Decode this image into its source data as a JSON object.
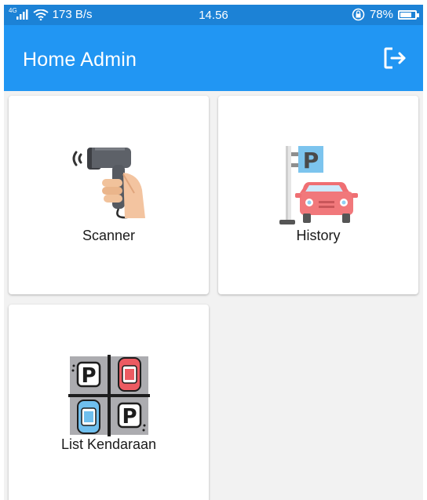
{
  "status_bar": {
    "network": "4G",
    "speed": "173 B/s",
    "time": "14.56",
    "battery": "78%",
    "battery_level": 0.78
  },
  "app_bar": {
    "title": "Home Admin",
    "action_icon": "logout-icon"
  },
  "menu": [
    {
      "label": "Scanner",
      "icon": "barcode-scanner-icon"
    },
    {
      "label": "History",
      "icon": "parking-car-icon"
    },
    {
      "label": "List Kendaraan",
      "icon": "parking-lot-icon"
    }
  ],
  "colors": {
    "status_bar": "#1c82d6",
    "app_bar": "#2196f3",
    "background": "#f2f2f2",
    "card": "#ffffff"
  }
}
